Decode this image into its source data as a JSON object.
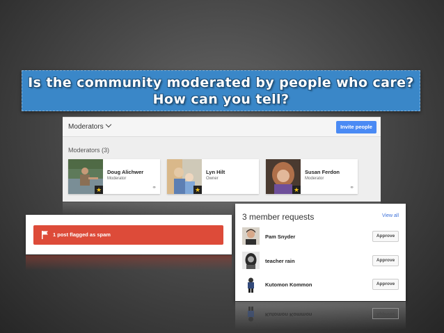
{
  "banner": {
    "line1": "Is the community moderated by people who care?",
    "line2": "How can you tell?"
  },
  "moderators": {
    "dropdown_label": "Moderators",
    "invite_button": "Invite people",
    "count_label": "Moderators (3)",
    "cards": [
      {
        "name": "Doug Alichwer",
        "role": "Moderator"
      },
      {
        "name": "Lyn Hilt",
        "role": "Owner"
      },
      {
        "name": "Susan Ferdon",
        "role": "Moderator"
      }
    ]
  },
  "spam": {
    "message": "1 post flagged as spam"
  },
  "requests": {
    "title": "3 member requests",
    "view_all": "View all",
    "approve_label": "Approve",
    "items": [
      {
        "name": "Pam Snyder"
      },
      {
        "name": "teacher rain"
      },
      {
        "name": "Kutomon Kommon"
      }
    ]
  },
  "colors": {
    "banner": "#3a87c8",
    "invite": "#4a8af4",
    "spam": "#dd4b39",
    "link": "#3a6fd8"
  }
}
